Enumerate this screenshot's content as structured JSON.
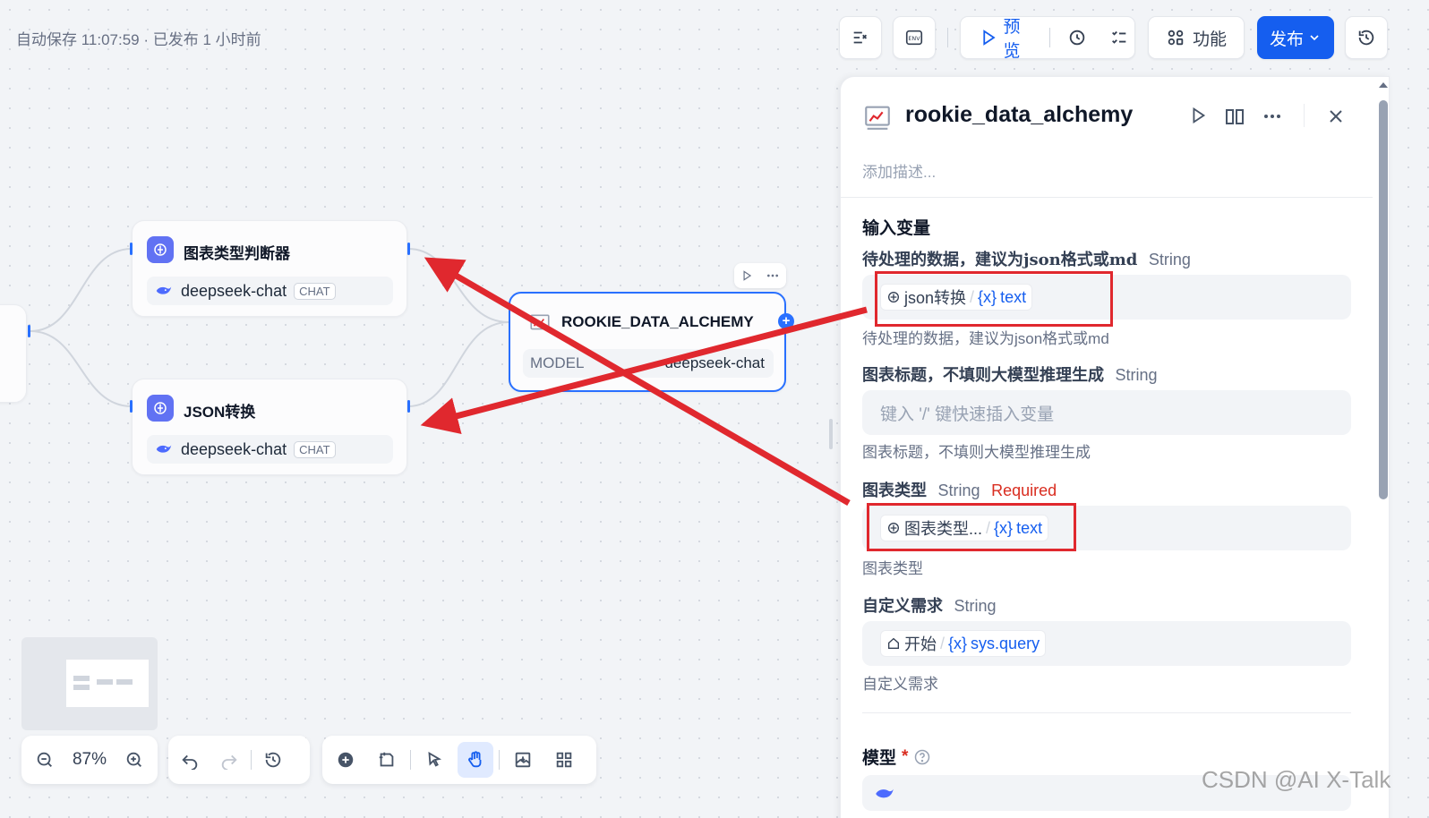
{
  "header": {
    "autosave": "自动保存 11:07:59 · 已发布 1 小时前",
    "preview_label": "预览",
    "features_label": "功能",
    "publish_label": "发布"
  },
  "nodes": {
    "classifier": {
      "title": "图表类型判断器",
      "model": "deepseek-chat",
      "badge": "CHAT"
    },
    "json_convert": {
      "title": "JSON转换",
      "model": "deepseek-chat",
      "badge": "CHAT"
    },
    "alchemy": {
      "title": "ROOKIE_DATA_ALCHEMY",
      "model_label": "MODEL",
      "model": "deepseek-chat"
    }
  },
  "panel": {
    "title": "rookie_data_alchemy",
    "description_placeholder": "添加描述...",
    "inputs_title": "输入变量",
    "vars": [
      {
        "label": "待处理的数据，建议为json格式或md",
        "type": "String",
        "chip_source": "json转换",
        "chip_var": "text",
        "hint": "待处理的数据，建议为json格式或md"
      },
      {
        "label": "图表标题，不填则大模型推理生成",
        "type": "String",
        "placeholder": "键入 '/' 键快速插入变量",
        "hint": "图表标题，不填则大模型推理生成"
      },
      {
        "label": "图表类型",
        "type": "String",
        "required": "Required",
        "chip_source": "图表类型...",
        "chip_var": "text",
        "hint": "图表类型"
      },
      {
        "label": "自定义需求",
        "type": "String",
        "chip_source": "开始",
        "chip_var": "sys.query",
        "hint": "自定义需求"
      }
    ],
    "model_title": "模型",
    "model_required_mark": "*"
  },
  "zoom": {
    "level": "87%"
  },
  "watermark": "CSDN @AI X-Talk",
  "colors": {
    "accent": "#155eef",
    "annotation_red": "#e0282e"
  }
}
